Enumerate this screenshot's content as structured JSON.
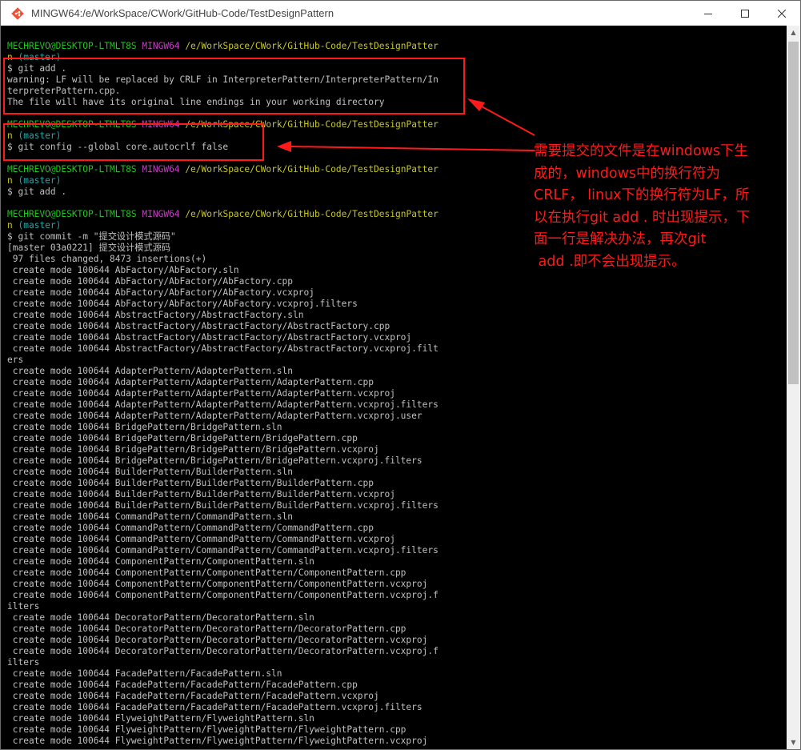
{
  "window": {
    "title": "MINGW64:/e/WorkSpace/CWork/GitHub-Code/TestDesignPattern"
  },
  "colors": {
    "prompt_user": "#1ec51e",
    "prompt_host": "#c040c0",
    "prompt_path": "#c8c820",
    "prompt_branch": "#20a8a8",
    "annotation": "#ff1a1a"
  },
  "annotation": {
    "lines": [
      "需要提交的文件是在windows下生",
      "成的，windows中的换行符为",
      "CRLF， linux下的换行符为LF，所",
      "以在执行git add . 时出现提示，下",
      "面一行是解决办法，再次git",
      " add .即不会出现提示。"
    ]
  },
  "terminal": {
    "prompt": {
      "user": "MECHREVO@DESKTOP-LTMLT8S",
      "host": "MINGW64",
      "path_a": "/e/WorkSpace/CWork/GitHub-Code/TestDesignPatter",
      "path_b": "n",
      "branch": "(master)"
    },
    "lines": [
      "",
      "$ git add .",
      "warning: LF will be replaced by CRLF in InterpreterPattern/InterpreterPattern/In",
      "terpreterPattern.cpp.",
      "The file will have its original line endings in your working directory",
      "",
      "$ git config --global core.autocrlf false",
      "",
      "$ git add .",
      "",
      "$ git commit -m \"提交设计模式源码\"",
      "[master 03a0221] 提交设计模式源码",
      " 97 files changed, 8473 insertions(+)",
      " create mode 100644 AbFactory/AbFactory.sln",
      " create mode 100644 AbFactory/AbFactory/AbFactory.cpp",
      " create mode 100644 AbFactory/AbFactory/AbFactory.vcxproj",
      " create mode 100644 AbFactory/AbFactory/AbFactory.vcxproj.filters",
      " create mode 100644 AbstractFactory/AbstractFactory.sln",
      " create mode 100644 AbstractFactory/AbstractFactory/AbstractFactory.cpp",
      " create mode 100644 AbstractFactory/AbstractFactory/AbstractFactory.vcxproj",
      " create mode 100644 AbstractFactory/AbstractFactory/AbstractFactory.vcxproj.filt",
      "ers",
      " create mode 100644 AdapterPattern/AdapterPattern.sln",
      " create mode 100644 AdapterPattern/AdapterPattern/AdapterPattern.cpp",
      " create mode 100644 AdapterPattern/AdapterPattern/AdapterPattern.vcxproj",
      " create mode 100644 AdapterPattern/AdapterPattern/AdapterPattern.vcxproj.filters",
      " create mode 100644 AdapterPattern/AdapterPattern/AdapterPattern.vcxproj.user",
      " create mode 100644 BridgePattern/BridgePattern.sln",
      " create mode 100644 BridgePattern/BridgePattern/BridgePattern.cpp",
      " create mode 100644 BridgePattern/BridgePattern/BridgePattern.vcxproj",
      " create mode 100644 BridgePattern/BridgePattern/BridgePattern.vcxproj.filters",
      " create mode 100644 BuilderPattern/BuilderPattern.sln",
      " create mode 100644 BuilderPattern/BuilderPattern/BuilderPattern.cpp",
      " create mode 100644 BuilderPattern/BuilderPattern/BuilderPattern.vcxproj",
      " create mode 100644 BuilderPattern/BuilderPattern/BuilderPattern.vcxproj.filters",
      " create mode 100644 CommandPattern/CommandPattern.sln",
      " create mode 100644 CommandPattern/CommandPattern/CommandPattern.cpp",
      " create mode 100644 CommandPattern/CommandPattern/CommandPattern.vcxproj",
      " create mode 100644 CommandPattern/CommandPattern/CommandPattern.vcxproj.filters",
      " create mode 100644 ComponentPattern/ComponentPattern.sln",
      " create mode 100644 ComponentPattern/ComponentPattern/ComponentPattern.cpp",
      " create mode 100644 ComponentPattern/ComponentPattern/ComponentPattern.vcxproj",
      " create mode 100644 ComponentPattern/ComponentPattern/ComponentPattern.vcxproj.f",
      "ilters",
      " create mode 100644 DecoratorPattern/DecoratorPattern.sln",
      " create mode 100644 DecoratorPattern/DecoratorPattern/DecoratorPattern.cpp",
      " create mode 100644 DecoratorPattern/DecoratorPattern/DecoratorPattern.vcxproj",
      " create mode 100644 DecoratorPattern/DecoratorPattern/DecoratorPattern.vcxproj.f",
      "ilters",
      " create mode 100644 FacadePattern/FacadePattern.sln",
      " create mode 100644 FacadePattern/FacadePattern/FacadePattern.cpp",
      " create mode 100644 FacadePattern/FacadePattern/FacadePattern.vcxproj",
      " create mode 100644 FacadePattern/FacadePattern/FacadePattern.vcxproj.filters",
      " create mode 100644 FlyweightPattern/FlyweightPattern.sln",
      " create mode 100644 FlyweightPattern/FlyweightPattern/FlyweightPattern.cpp",
      " create mode 100644 FlyweightPattern/FlyweightPattern/FlyweightPattern.vcxproj"
    ]
  }
}
